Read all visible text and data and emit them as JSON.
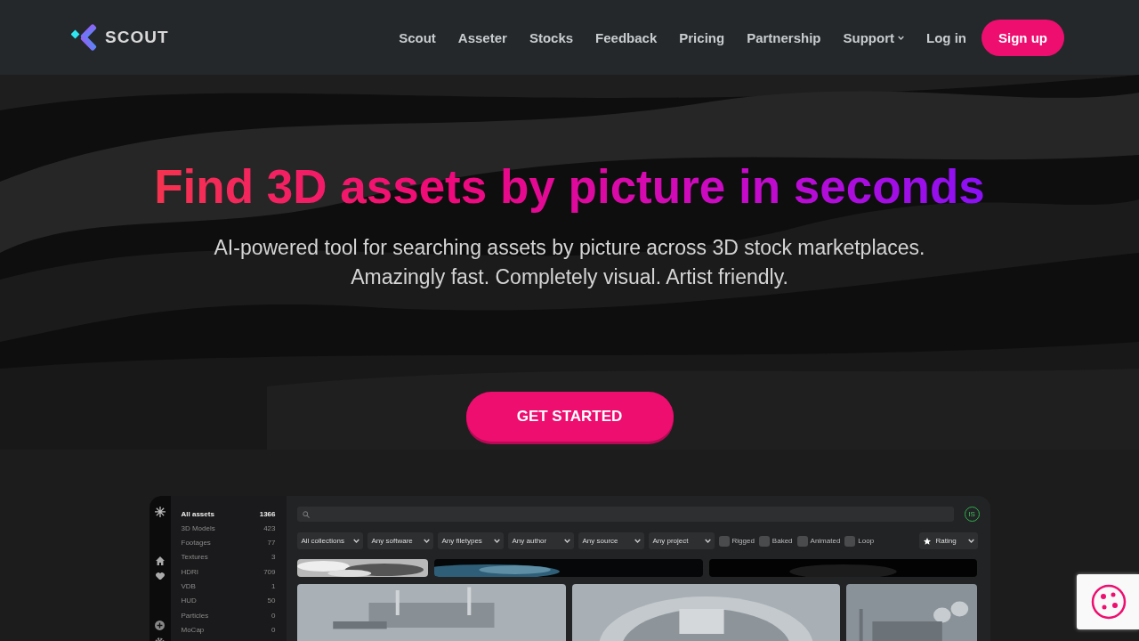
{
  "nav": {
    "logo": "SCOUT",
    "links": [
      {
        "label": "Scout",
        "kind": "link"
      },
      {
        "label": "Asseter",
        "kind": "link"
      },
      {
        "label": "Stocks",
        "kind": "link"
      },
      {
        "label": "Feedback",
        "kind": "link"
      },
      {
        "label": "Pricing",
        "kind": "link"
      },
      {
        "label": "Partnership",
        "kind": "link"
      },
      {
        "label": "Support",
        "kind": "dropdown"
      }
    ],
    "login": "Log in",
    "signup": "Sign up"
  },
  "hero": {
    "title": "Find 3D assets by picture in seconds",
    "subtitle": [
      "AI-powered tool for searching assets by picture across 3D stock marketplaces.",
      "Amazingly fast. Completely visual. Artist friendly."
    ],
    "cta": "GET STARTED"
  },
  "app": {
    "categories": [
      {
        "label": "All assets",
        "count": "1366",
        "selected": true
      },
      {
        "label": "3D Models",
        "count": "423",
        "selected": false
      },
      {
        "label": "Footages",
        "count": "77",
        "selected": false
      },
      {
        "label": "Textures",
        "count": "3",
        "selected": false
      },
      {
        "label": "HDRI",
        "count": "709",
        "selected": false
      },
      {
        "label": "VDB",
        "count": "1",
        "selected": false
      },
      {
        "label": "HUD",
        "count": "50",
        "selected": false
      },
      {
        "label": "Particles",
        "count": "0",
        "selected": false
      },
      {
        "label": "MoCap",
        "count": "0",
        "selected": false
      }
    ],
    "filters": [
      {
        "kind": "select",
        "label": "All collections"
      },
      {
        "kind": "select",
        "label": "Any software"
      },
      {
        "kind": "select",
        "label": "Any filetypes"
      },
      {
        "kind": "select",
        "label": "Any author"
      },
      {
        "kind": "select",
        "label": "Any source"
      },
      {
        "kind": "select",
        "label": "Any project"
      },
      {
        "kind": "checkbox",
        "label": "Rigged",
        "checked": false
      },
      {
        "kind": "checkbox",
        "label": "Baked",
        "checked": false
      },
      {
        "kind": "checkbox",
        "label": "Animated",
        "checked": false
      },
      {
        "kind": "checkbox",
        "label": "Loop",
        "checked": false
      }
    ],
    "sort": "Rating",
    "avatar": "IS"
  }
}
